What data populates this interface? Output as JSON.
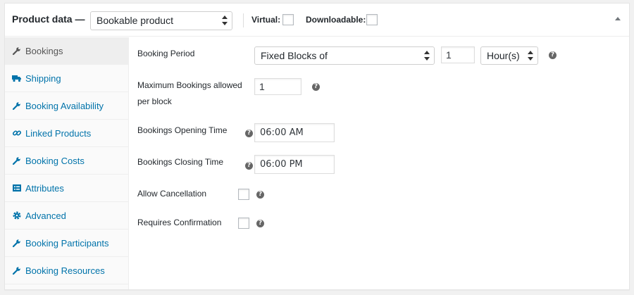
{
  "header": {
    "title": "Product data —",
    "product_type": "Bookable product",
    "virtual_label": "Virtual:",
    "downloadable_label": "Downloadable:"
  },
  "tabs": [
    {
      "label": "Bookings",
      "icon": "wrench-icon",
      "active": true
    },
    {
      "label": "Shipping",
      "icon": "truck-icon",
      "active": false
    },
    {
      "label": "Booking Availability",
      "icon": "wrench-icon",
      "active": false
    },
    {
      "label": "Linked Products",
      "icon": "link-icon",
      "active": false
    },
    {
      "label": "Booking Costs",
      "icon": "wrench-icon",
      "active": false
    },
    {
      "label": "Attributes",
      "icon": "list-icon",
      "active": false
    },
    {
      "label": "Advanced",
      "icon": "gear-icon",
      "active": false
    },
    {
      "label": "Booking Participants",
      "icon": "wrench-icon",
      "active": false
    },
    {
      "label": "Booking Resources",
      "icon": "wrench-icon",
      "active": false
    }
  ],
  "fields": {
    "booking_period": {
      "label": "Booking Period",
      "mode": "Fixed Blocks of",
      "amount": "1",
      "unit": "Hour(s)"
    },
    "max_bookings": {
      "label_line1": "Maximum Bookings allowed",
      "label_line2": "per block",
      "value": "1"
    },
    "opening_time": {
      "label": "Bookings Opening Time",
      "value": "06:00 AM"
    },
    "closing_time": {
      "label": "Bookings Closing Time",
      "value": "06:00 PM"
    },
    "allow_cancellation": {
      "label": "Allow Cancellation"
    },
    "requires_confirmation": {
      "label": "Requires Confirmation"
    }
  },
  "help_glyph": "?"
}
